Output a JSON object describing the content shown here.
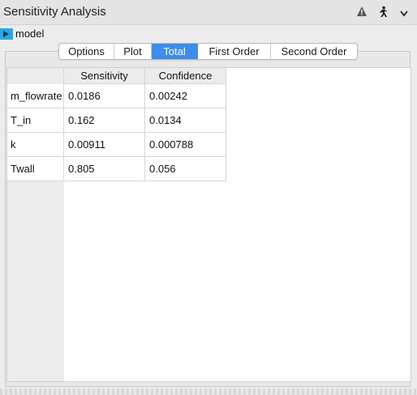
{
  "window": {
    "title": "Sensitivity Analysis"
  },
  "toolbar_icons": [
    "warning-icon",
    "run-icon",
    "chevron-down-icon"
  ],
  "model": {
    "label": "model",
    "icon": "model-icon",
    "icon_color": "#29a9e0"
  },
  "tabs": [
    {
      "label": "Options",
      "active": false
    },
    {
      "label": "Plot",
      "active": false
    },
    {
      "label": "Total",
      "active": true
    },
    {
      "label": "First Order",
      "active": false
    },
    {
      "label": "Second Order",
      "active": false
    }
  ],
  "table": {
    "columns": [
      "Sensitivity",
      "Confidence"
    ],
    "rows": [
      {
        "name": "m_flowrate",
        "values": [
          "0.0186",
          "0.00242"
        ]
      },
      {
        "name": "T_in",
        "values": [
          "0.162",
          "0.0134"
        ]
      },
      {
        "name": "k",
        "values": [
          "0.00911",
          "0.000788"
        ]
      },
      {
        "name": "Twall",
        "values": [
          "0.805",
          "0.056"
        ]
      }
    ]
  },
  "colors": {
    "accent": "#3d8ee8"
  }
}
